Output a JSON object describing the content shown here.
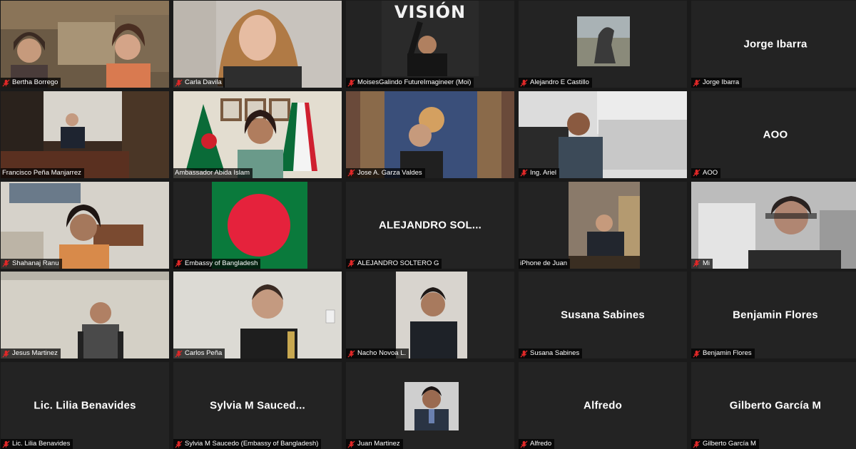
{
  "meeting": {
    "participants": [
      {
        "name": "Bertha Borrego",
        "big": "",
        "muted": true,
        "video": true
      },
      {
        "name": "Carla Davila",
        "big": "",
        "muted": true,
        "video": true
      },
      {
        "name": "MoisesGalindo FutureImagineer (Moi)",
        "big": "",
        "muted": true,
        "video": true,
        "overlay": "VISIÓN"
      },
      {
        "name": "Alejandro E Castillo",
        "big": "",
        "muted": true,
        "video": true
      },
      {
        "name": "Jorge Ibarra",
        "big": "Jorge Ibarra",
        "muted": true,
        "video": false
      },
      {
        "name": "Francisco Peña Manjarrez",
        "big": "",
        "muted": false,
        "video": true
      },
      {
        "name": "Ambassador Abida Islam",
        "big": "",
        "muted": false,
        "video": true,
        "speaking": true
      },
      {
        "name": "Jose A. Garza Valdes",
        "big": "",
        "muted": true,
        "video": true
      },
      {
        "name": "Ing. Ariel",
        "big": "",
        "muted": true,
        "video": true
      },
      {
        "name": "AOO",
        "big": "AOO",
        "muted": true,
        "video": false
      },
      {
        "name": "Shahanaj Ranu",
        "big": "",
        "muted": true,
        "video": true
      },
      {
        "name": "Embassy of Bangladesh",
        "big": "",
        "muted": true,
        "video": true
      },
      {
        "name": "ALEJANDRO SOLTERO G",
        "big": "ALEJANDRO  SOL...",
        "muted": true,
        "video": false
      },
      {
        "name": "iPhone de Juan",
        "big": "",
        "muted": false,
        "video": true
      },
      {
        "name": "Mi",
        "big": "",
        "muted": true,
        "video": true
      },
      {
        "name": "Jesus Martinez",
        "big": "",
        "muted": true,
        "video": true
      },
      {
        "name": "Carlos Peña",
        "big": "",
        "muted": true,
        "video": true
      },
      {
        "name": "Nacho Novoa L.",
        "big": "",
        "muted": true,
        "video": true
      },
      {
        "name": "Susana Sabines",
        "big": "Susana Sabines",
        "muted": true,
        "video": false
      },
      {
        "name": "Benjamin Flores",
        "big": "Benjamin Flores",
        "muted": true,
        "video": false
      },
      {
        "name": "Lic. Lilia Benavides",
        "big": "Lic. Lilia Benavides",
        "muted": true,
        "video": false
      },
      {
        "name": "Sylvia M Saucedo (Embassy of Bangladesh)",
        "big": "Sylvia  M  Sauced...",
        "muted": true,
        "video": false
      },
      {
        "name": "Juan Martinez",
        "big": "",
        "muted": true,
        "video": true
      },
      {
        "name": "Alfredo",
        "big": "Alfredo",
        "muted": true,
        "video": false
      },
      {
        "name": "Gilberto García M",
        "big": "Gilberto García M",
        "muted": true,
        "video": false
      }
    ]
  },
  "colors": {
    "mute_icon": "#e02828",
    "speaker_outline": "#d7e23a",
    "tile_bg": "#232323",
    "bangladesh_green": "#0a7a3c",
    "bangladesh_red": "#e5223c"
  },
  "icons": {
    "muted": "mic-muted-icon"
  }
}
